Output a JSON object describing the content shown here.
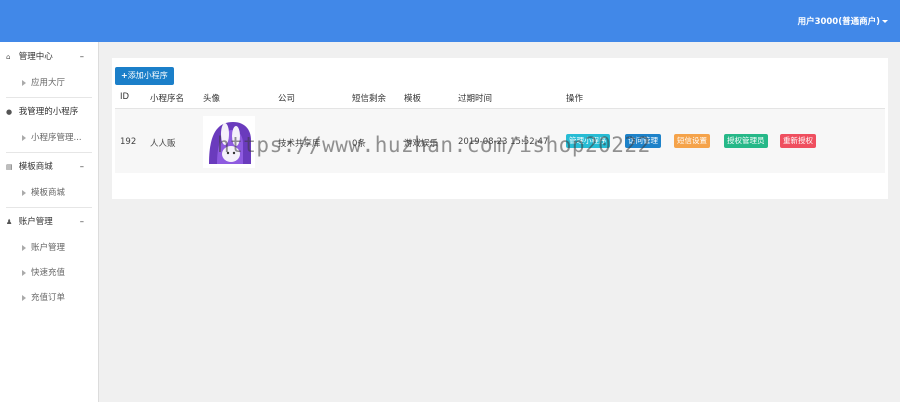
{
  "header": {
    "user_label": "用户3000(普通商户)"
  },
  "sidebar": {
    "groups": [
      {
        "label": "管理中心",
        "icon": "home-icon",
        "collapse": "–",
        "items": [
          {
            "label": "应用大厅"
          }
        ]
      },
      {
        "label": "我管理的小程序",
        "icon": "wechat-icon",
        "collapse": "",
        "items": [
          {
            "label": "小程序管理..."
          }
        ]
      },
      {
        "label": "模板商城",
        "icon": "cart-icon",
        "collapse": "–",
        "items": [
          {
            "label": "模板商城"
          }
        ]
      },
      {
        "label": "账户管理",
        "icon": "user-icon",
        "collapse": "–",
        "items": [
          {
            "label": "账户管理"
          },
          {
            "label": "快速充值"
          },
          {
            "label": "充值订单"
          }
        ]
      }
    ]
  },
  "main": {
    "add_button_label": "添加小程序",
    "columns": [
      "ID",
      "小程序名",
      "头像",
      "公司",
      "短信剩余",
      "模板",
      "过期时间",
      "操作"
    ],
    "rows": [
      {
        "id": "192",
        "name": "人人贩",
        "company": "技术共享库",
        "sms_remaining": "0条",
        "template": "游戏娱乐",
        "expire_time": "2019-08-23 15:52:47",
        "actions": [
          {
            "label": "管理小程序",
            "color": "#27bcd4"
          },
          {
            "label": "访问管理",
            "color": "#1d82c9"
          },
          {
            "label": "短信设置",
            "color": "#f5a34a"
          },
          {
            "label": "授权管理员",
            "color": "#26b888"
          },
          {
            "label": "重新授权",
            "color": "#ef4f5f"
          }
        ]
      }
    ]
  },
  "watermark": "https://www.huzhan.com/ishop20222",
  "colors": {
    "header_bg": "#4188e8",
    "add_button": "#1b7fc9"
  }
}
